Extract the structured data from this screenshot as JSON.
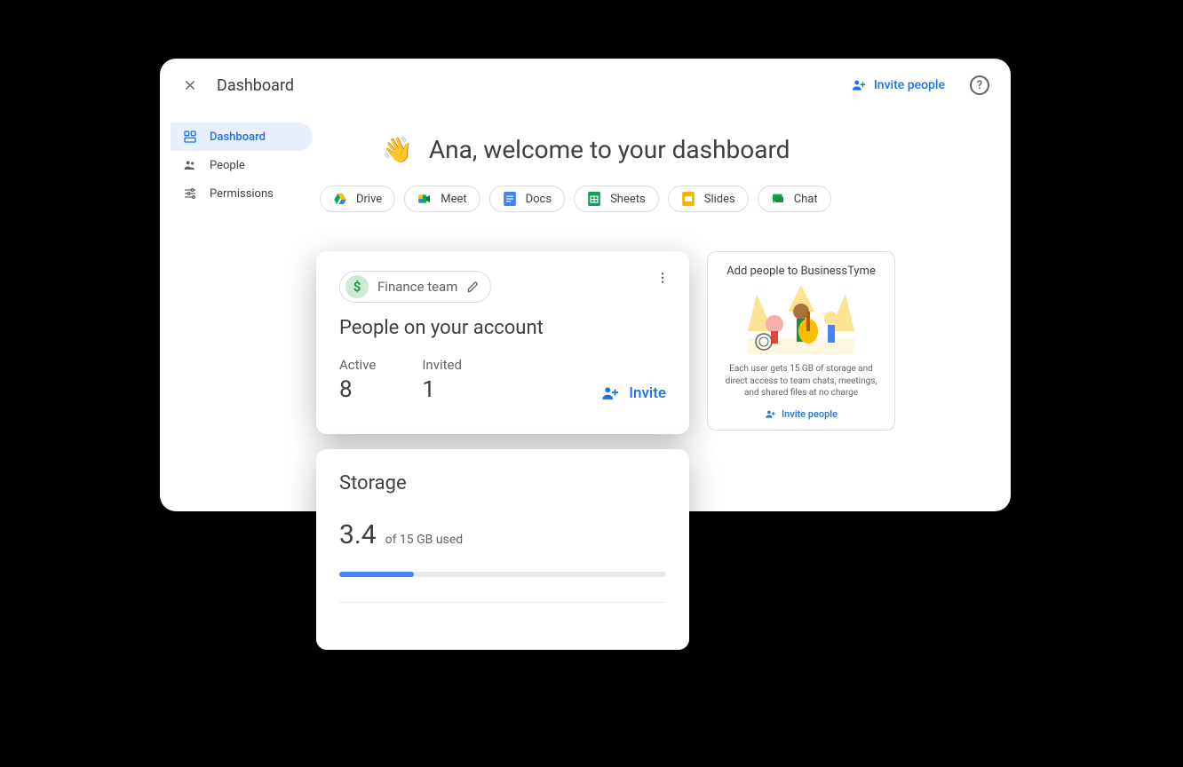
{
  "header": {
    "title": "Dashboard",
    "invite_label": "Invite people"
  },
  "sidebar": {
    "items": [
      {
        "label": "Dashboard"
      },
      {
        "label": "People"
      },
      {
        "label": "Permissions"
      }
    ]
  },
  "welcome": {
    "emoji": "👋",
    "text": "Ana, welcome to your dashboard"
  },
  "apps": [
    {
      "label": "Drive"
    },
    {
      "label": "Meet"
    },
    {
      "label": "Docs"
    },
    {
      "label": "Sheets"
    },
    {
      "label": "Slides"
    },
    {
      "label": "Chat"
    }
  ],
  "people_card": {
    "team_name": "Finance team",
    "title": "People on your account",
    "active_label": "Active",
    "active_count": "8",
    "invited_label": "Invited",
    "invited_count": "1",
    "invite_label": "Invite"
  },
  "promo": {
    "title": "Add people to BusinessTyme",
    "desc": "Each user gets 15 GB of storage and direct access to team chats, meetings, and shared files at no charge",
    "invite_label": "Invite people"
  },
  "storage": {
    "title": "Storage",
    "value": "3.4",
    "of_text": "of 15 GB used",
    "percent": 22.7
  }
}
